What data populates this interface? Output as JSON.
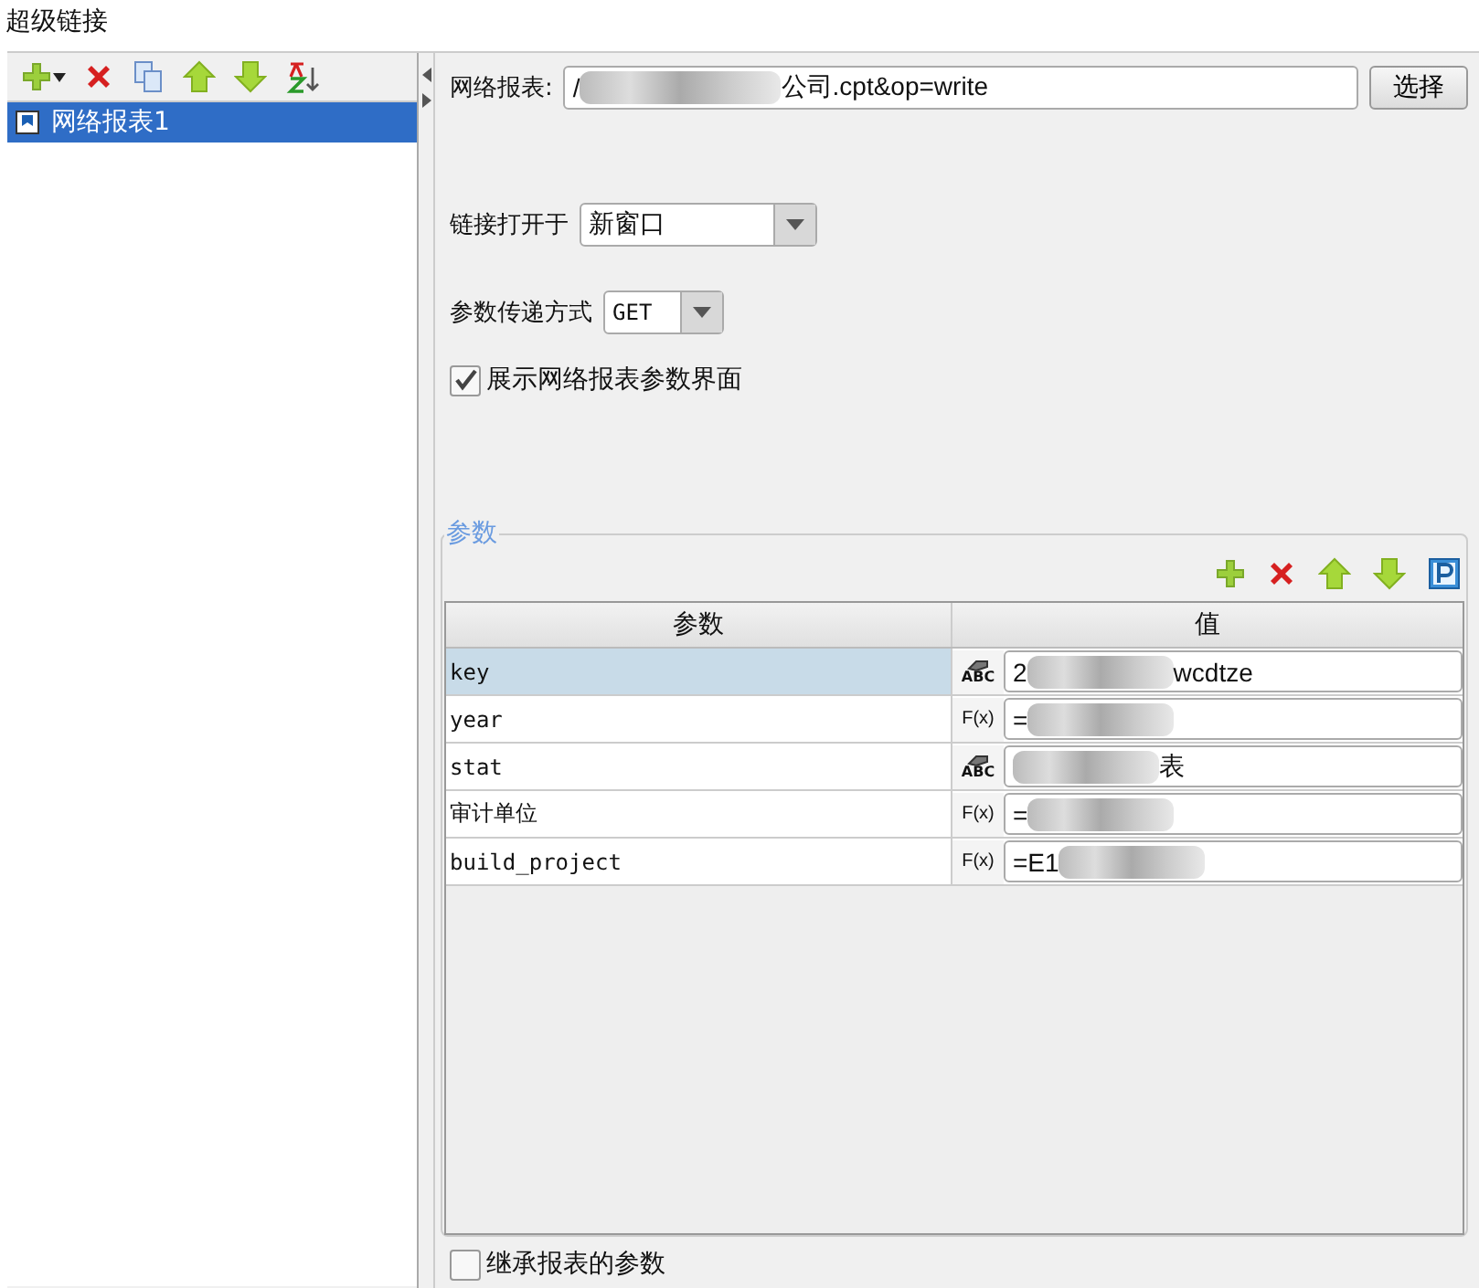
{
  "window": {
    "title": "超级链接"
  },
  "left_toolbar": {
    "tools": [
      {
        "kind": "add"
      },
      {
        "kind": "delete"
      },
      {
        "kind": "copy"
      },
      {
        "kind": "up"
      },
      {
        "kind": "down"
      },
      {
        "kind": "sort"
      }
    ]
  },
  "links": [
    {
      "label": "网络报表1",
      "selected": true
    }
  ],
  "report": {
    "label": "网络报表:",
    "value": {
      "before": "/",
      "after": "公司.cpt&op=write"
    },
    "button": "选择"
  },
  "open_in": {
    "label": "链接打开于",
    "value": "新窗口"
  },
  "method": {
    "label": "参数传递方式",
    "value": "GET"
  },
  "show_params": {
    "label": "展示网络报表参数界面",
    "checked": true
  },
  "params": {
    "legend": "参数",
    "tools": [
      {
        "kind": "add"
      },
      {
        "kind": "delete"
      },
      {
        "kind": "up"
      },
      {
        "kind": "down"
      },
      {
        "kind": "p"
      }
    ],
    "columns": [
      "参数",
      "值"
    ],
    "rows": [
      {
        "name": "key",
        "kind": "text",
        "type_label": "ABC",
        "value": {
          "before": "2",
          "after": "wcdtze"
        },
        "selected": true
      },
      {
        "name": "year",
        "kind": "formula",
        "type_label": "F(x)",
        "value": {
          "before": "="
        },
        "selected": false
      },
      {
        "name": "stat",
        "kind": "text",
        "type_label": "ABC",
        "value": {
          "after": "表"
        },
        "selected": false
      },
      {
        "name": "审计单位",
        "kind": "formula",
        "type_label": "F(x)",
        "value": {
          "before": "="
        },
        "selected": false
      },
      {
        "name": "build_project",
        "kind": "formula",
        "type_label": "F(x)",
        "value": {
          "before": "=E1"
        },
        "selected": false
      }
    ]
  },
  "inherit": {
    "label": "继承报表的参数",
    "checked": false
  }
}
